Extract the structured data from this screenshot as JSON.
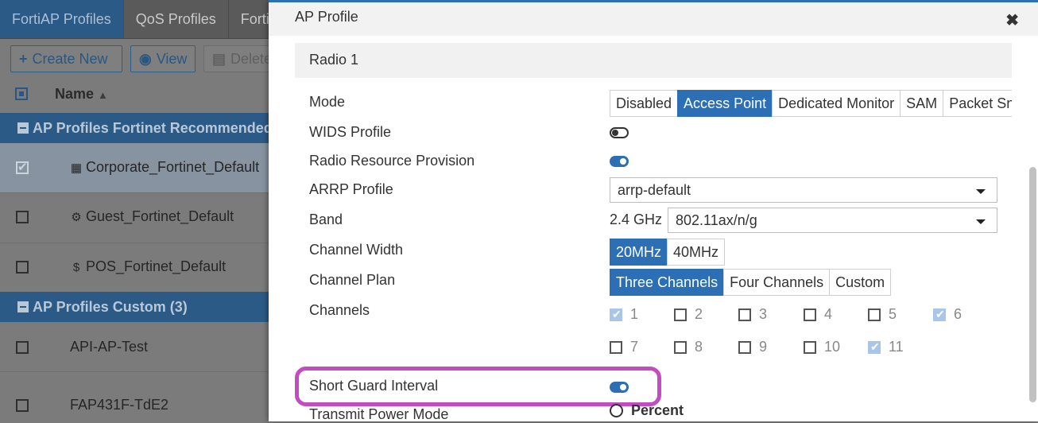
{
  "background": {
    "tabs": [
      {
        "label": "FortiAP Profiles",
        "active": true
      },
      {
        "label": "QoS Profiles",
        "active": false
      },
      {
        "label": "Forti",
        "active": false
      }
    ],
    "toolbar": {
      "create_label": "Create New",
      "view_label": "View",
      "delete_label": "Delete"
    },
    "table": {
      "name_header": "Name",
      "group_recommended": "AP Profiles Fortinet Recommended -",
      "group_custom": "AP Profiles Custom (3)",
      "rows": [
        {
          "name": "Corporate_Fortinet_Default",
          "icon": "building-icon",
          "selected": true
        },
        {
          "name": "Guest_Fortinet_Default",
          "icon": "user-gear-icon",
          "selected": false
        },
        {
          "name": "POS_Fortinet_Default",
          "icon": "dollar-icon",
          "selected": false
        },
        {
          "name": "API-AP-Test",
          "icon": "",
          "selected": false
        },
        {
          "name": "FAP431F-TdE2",
          "icon": "",
          "selected": false
        }
      ]
    }
  },
  "modal": {
    "title": "AP Profile",
    "section": "Radio 1",
    "labels": {
      "mode": "Mode",
      "wids": "WIDS Profile",
      "rrp": "Radio Resource Provision",
      "arrp": "ARRP Profile",
      "band": "Band",
      "channel_width": "Channel Width",
      "channel_plan": "Channel Plan",
      "channels": "Channels",
      "sgi": "Short Guard Interval",
      "tpm": "Transmit Power Mode"
    },
    "mode_options": [
      "Disabled",
      "Access Point",
      "Dedicated Monitor",
      "SAM",
      "Packet Sn"
    ],
    "mode_selected": "Access Point",
    "wids_enabled": false,
    "rrp_enabled": true,
    "arrp_value": "arrp-default",
    "band_prefix": "2.4 GHz",
    "band_value": "802.11ax/n/g",
    "channel_width_options": [
      "20MHz",
      "40MHz"
    ],
    "channel_width_selected": "20MHz",
    "channel_plan_options": [
      "Three Channels",
      "Four Channels",
      "Custom"
    ],
    "channel_plan_selected": "Three Channels",
    "channels": [
      {
        "label": "1",
        "checked": true
      },
      {
        "label": "2",
        "checked": false
      },
      {
        "label": "3",
        "checked": false
      },
      {
        "label": "4",
        "checked": false
      },
      {
        "label": "5",
        "checked": false
      },
      {
        "label": "6",
        "checked": true
      },
      {
        "label": "7",
        "checked": false
      },
      {
        "label": "8",
        "checked": false
      },
      {
        "label": "9",
        "checked": false
      },
      {
        "label": "10",
        "checked": false
      },
      {
        "label": "11",
        "checked": true
      }
    ],
    "sgi_enabled": true,
    "tpm_option": "Percent",
    "highlight_color": "#c34cc2",
    "accent_color": "#2c6fb4"
  }
}
